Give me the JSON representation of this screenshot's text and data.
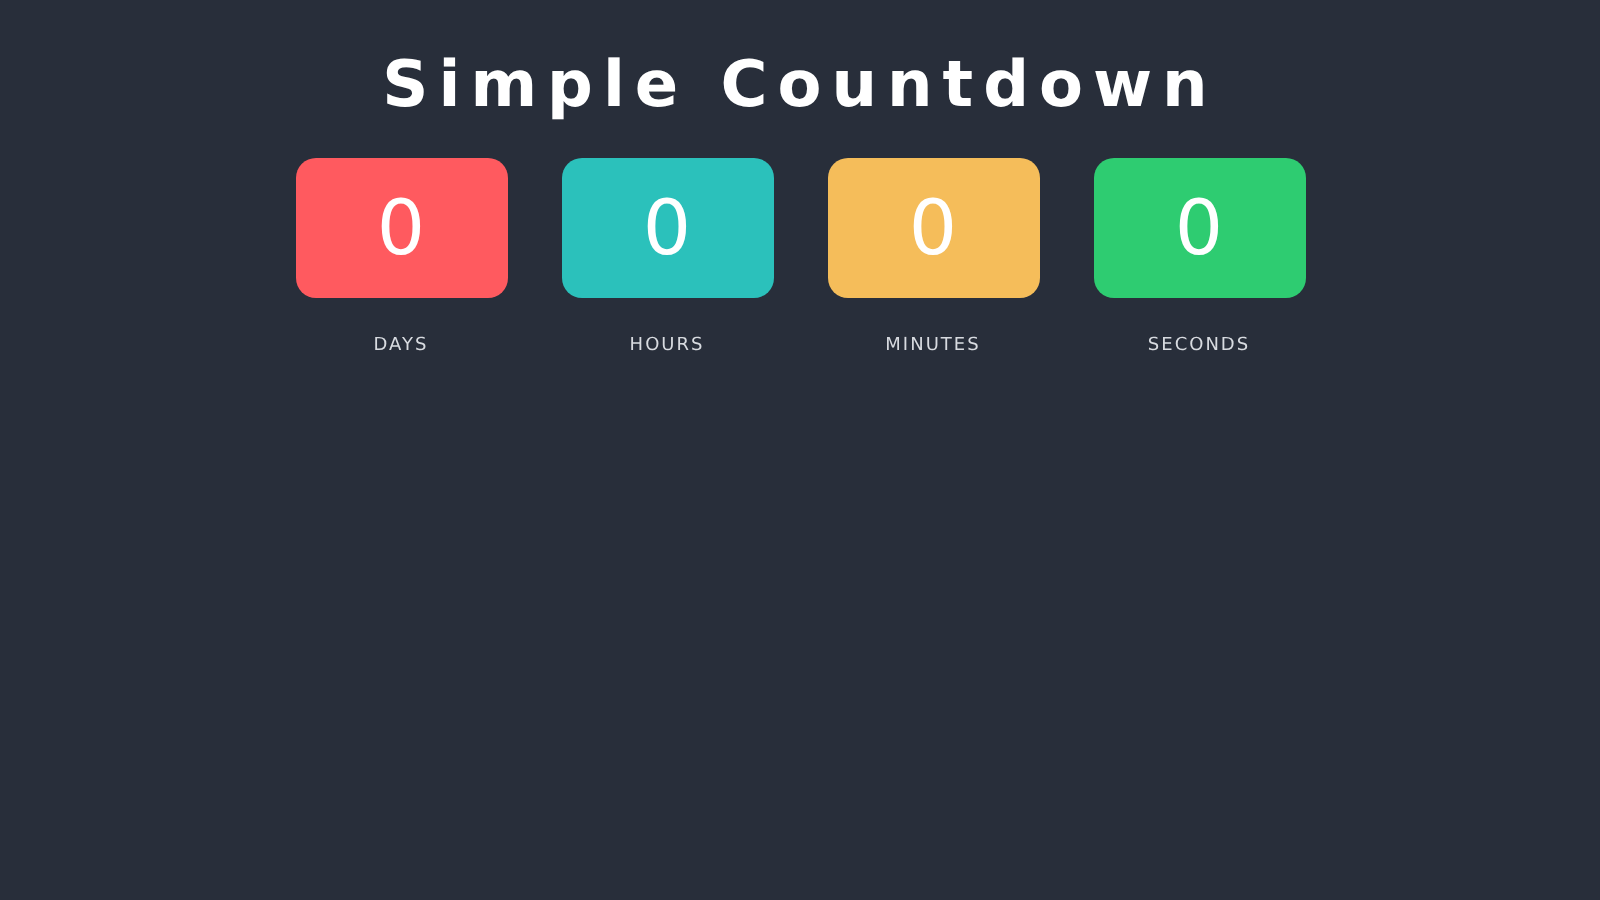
{
  "title": "Simple Countdown",
  "units": [
    {
      "value": "0",
      "label": "DAYS",
      "color": "#ff5a5f"
    },
    {
      "value": "0",
      "label": "HOURS",
      "color": "#2bc1bb"
    },
    {
      "value": "0",
      "label": "MINUTES",
      "color": "#f5bd5a"
    },
    {
      "value": "0",
      "label": "SECONDS",
      "color": "#2ecc71"
    }
  ]
}
